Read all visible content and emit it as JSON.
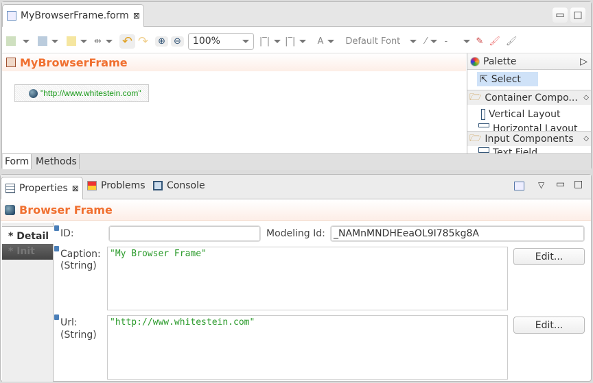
{
  "editor": {
    "tab_label": "MyBrowserFrame.form",
    "zoom": "100%",
    "font_label": "Default Font",
    "font_color_label": "A",
    "line_style": "-",
    "form_title": "MyBrowserFrame",
    "browser_url": "\"http://www.whitestein.com\"",
    "bottom_tabs": [
      "Form",
      "Methods"
    ]
  },
  "palette": {
    "title": "Palette",
    "select": "Select",
    "groups": [
      {
        "label": "Container Compo...",
        "items": [
          "Vertical Layout",
          "Horizontal Layout"
        ]
      },
      {
        "label": "Input Components",
        "items": [
          "Text Field"
        ]
      }
    ]
  },
  "bottom": {
    "tabs": [
      "Properties",
      "Problems",
      "Console"
    ],
    "title": "Browser Frame",
    "side_tabs": [
      "* Detail",
      "* Init"
    ],
    "fields": {
      "id_label": "ID:",
      "id_value": "",
      "modeling_label": "Modeling Id:",
      "modeling_value": "_NAMnMNDHEeaOL9I785kg8A",
      "caption_label": "Caption:",
      "caption_type": "(String)",
      "caption_value": "\"My Browser Frame\"",
      "url_label": "Url:",
      "url_type": "(String)",
      "url_value": "\"http://www.whitestein.com\"",
      "edit_label": "Edit..."
    }
  }
}
